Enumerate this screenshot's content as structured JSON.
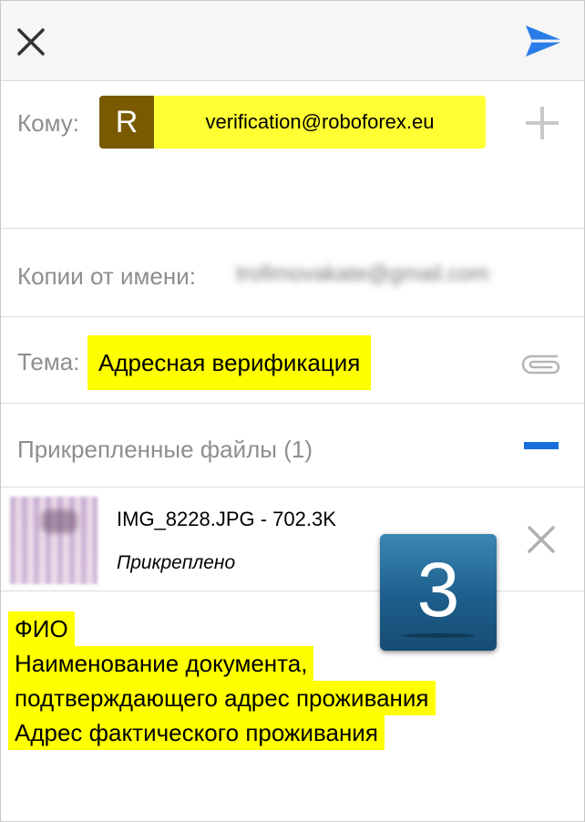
{
  "compose": {
    "to_label": "Кому:",
    "recipient_initial": "R",
    "recipient_email": "verification@roboforex.eu",
    "from_label": "Копии от имени:",
    "from_email": "trofimovakate@gmail.com",
    "subject_label": "Тема:",
    "subject_value": "Адресная верификация",
    "attachments_label": "Прикрепленные файлы (1)",
    "attachment": {
      "name": "IMG_8228.JPG - 702.3K",
      "status": "Прикреплено"
    },
    "body_lines": [
      "ФИО",
      "Наименование документа,",
      "подтверждающего адрес проживания",
      "Адрес фактического проживания"
    ]
  },
  "step_badge": "3",
  "colors": {
    "highlight": "#ffff00",
    "accent_blue": "#1a6fde",
    "avatar_bg": "#7a5a00",
    "badge_blue": "#1d5e8c"
  },
  "icons": [
    "close-icon",
    "send-icon",
    "plus-icon",
    "paperclip-icon",
    "minus-icon",
    "remove-icon"
  ]
}
